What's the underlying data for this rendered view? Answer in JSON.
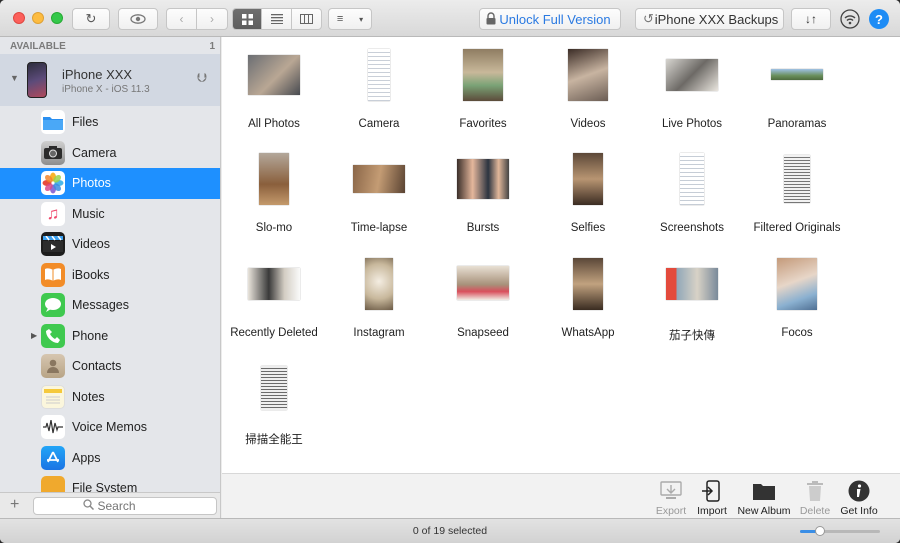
{
  "toolbar": {
    "unlock_label": "Unlock Full Version",
    "backups_label": "iPhone XXX Backups"
  },
  "sidebar": {
    "section_label": "AVAILABLE",
    "section_count": "1",
    "device": {
      "name": "iPhone XXX",
      "subtitle": "iPhone X - iOS 11.3"
    },
    "items": [
      {
        "label": "Files",
        "icon": "files-icon",
        "color": "#3b9cf0"
      },
      {
        "label": "Camera",
        "icon": "camera-icon",
        "color": "#4a4a4a"
      },
      {
        "label": "Photos",
        "icon": "photos-icon",
        "color": "#ffffff",
        "selected": true
      },
      {
        "label": "Music",
        "icon": "music-icon",
        "color": "#ffffff"
      },
      {
        "label": "Videos",
        "icon": "videos-icon",
        "color": "#1d1d1d"
      },
      {
        "label": "iBooks",
        "icon": "ibooks-icon",
        "color": "#f28c28"
      },
      {
        "label": "Messages",
        "icon": "messages-icon",
        "color": "#3fc94f"
      },
      {
        "label": "Phone",
        "icon": "phone-icon",
        "color": "#3fc94f",
        "expandable": true
      },
      {
        "label": "Contacts",
        "icon": "contacts-icon",
        "color": "#c9b7a0"
      },
      {
        "label": "Notes",
        "icon": "notes-icon",
        "color": "#f6f1d4"
      },
      {
        "label": "Voice Memos",
        "icon": "voice-memos-icon",
        "color": "#ffffff"
      },
      {
        "label": "Apps",
        "icon": "apps-icon",
        "color": "#1b8cf3"
      },
      {
        "label": "File System",
        "icon": "file-system-icon",
        "color": "#f0a92d"
      }
    ],
    "search_placeholder": "Search"
  },
  "albums": [
    {
      "label": "All Photos"
    },
    {
      "label": "Camera"
    },
    {
      "label": "Favorites"
    },
    {
      "label": "Videos"
    },
    {
      "label": "Live Photos"
    },
    {
      "label": "Panoramas"
    },
    {
      "label": "Slo-mo"
    },
    {
      "label": "Time-lapse"
    },
    {
      "label": "Bursts"
    },
    {
      "label": "Selfies"
    },
    {
      "label": "Screenshots"
    },
    {
      "label": "Filtered Originals"
    },
    {
      "label": "Recently Deleted"
    },
    {
      "label": "Instagram"
    },
    {
      "label": "Snapseed"
    },
    {
      "label": "WhatsApp"
    },
    {
      "label": "茄子快傳"
    },
    {
      "label": "Focos"
    },
    {
      "label": "掃描全能王"
    }
  ],
  "actions": {
    "export": "Export",
    "import": "Import",
    "new_album": "New Album",
    "delete": "Delete",
    "get_info": "Get Info"
  },
  "status": {
    "selection": "0 of 19 selected",
    "zoom_level": 0.25
  },
  "colors": {
    "accent": "#1e90ff",
    "link": "#2a7ae2"
  }
}
